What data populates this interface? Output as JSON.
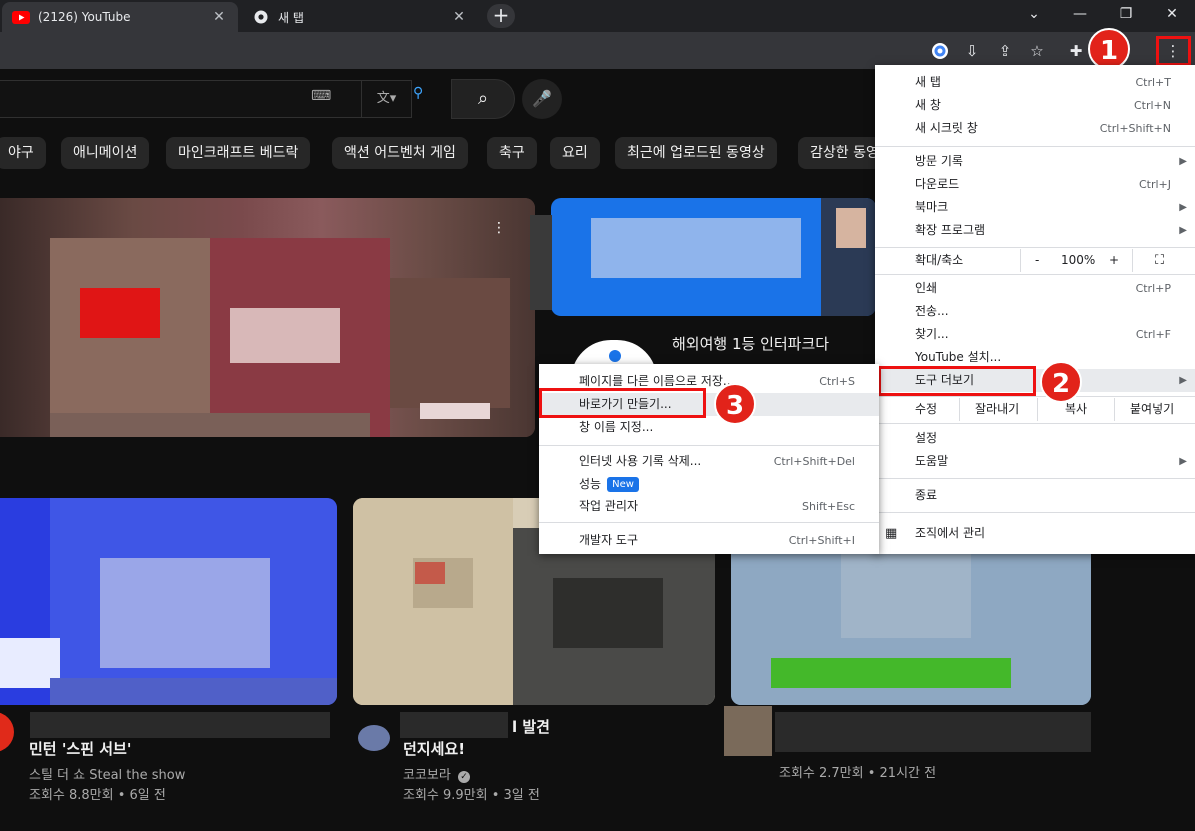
{
  "tabs": [
    {
      "title": "(2126) YouTube"
    },
    {
      "title": "새 탭"
    }
  ],
  "chips": [
    "야구",
    "애니메이션",
    "마인크래프트 베드락",
    "액션 어드벤처 게임",
    "축구",
    "요리",
    "최근에 업로드된 동영상",
    "감상한 동영"
  ],
  "ad": {
    "title": "해외여행 1등 인터파크다"
  },
  "videos": [
    {
      "title": "민턴 '스핀 서브'",
      "channel": "스틸 더 쇼 Steal the show",
      "meta": "조회수 8.8만회 • 6일 전"
    },
    {
      "title": "던지세요!",
      "channel": "코코보라",
      "meta": "조회수 9.9만회 • 3일 전",
      "extra": "l 발견"
    },
    {
      "title": "",
      "channel": "",
      "meta": "조회수 2.7만회 • 21시간 전"
    }
  ],
  "menu": {
    "new_tab": "새 탭",
    "new_tab_sc": "Ctrl+T",
    "new_window": "새 창",
    "new_window_sc": "Ctrl+N",
    "incognito": "새 시크릿 창",
    "incognito_sc": "Ctrl+Shift+N",
    "history": "방문 기록",
    "downloads": "다운로드",
    "downloads_sc": "Ctrl+J",
    "bookmarks": "북마크",
    "extensions": "확장 프로그램",
    "zoom_label": "확대/축소",
    "zoom_minus": "-",
    "zoom_value": "100%",
    "zoom_plus": "+",
    "print": "인쇄",
    "print_sc": "Ctrl+P",
    "cast": "전송...",
    "find": "찾기...",
    "find_sc": "Ctrl+F",
    "install": "YouTube 설치...",
    "more_tools": "도구 더보기",
    "edit": "수정",
    "cut": "잘라내기",
    "copy": "복사",
    "paste": "붙여넣기",
    "settings": "설정",
    "help": "도움말",
    "exit": "종료",
    "managed": "조직에서 관리"
  },
  "submenu": {
    "save_as": "페이지를 다른 이름으로 저장...",
    "save_as_sc": "Ctrl+S",
    "shortcut": "바로가기 만들기...",
    "name_window": "창 이름 지정...",
    "clear_data": "인터넷 사용 기록 삭제...",
    "clear_data_sc": "Ctrl+Shift+Del",
    "performance": "성능",
    "new_badge": "New",
    "task_manager": "작업 관리자",
    "task_manager_sc": "Shift+Esc",
    "devtools": "개발자 도구",
    "devtools_sc": "Ctrl+Shift+I"
  },
  "badges": [
    "1",
    "2",
    "3"
  ]
}
